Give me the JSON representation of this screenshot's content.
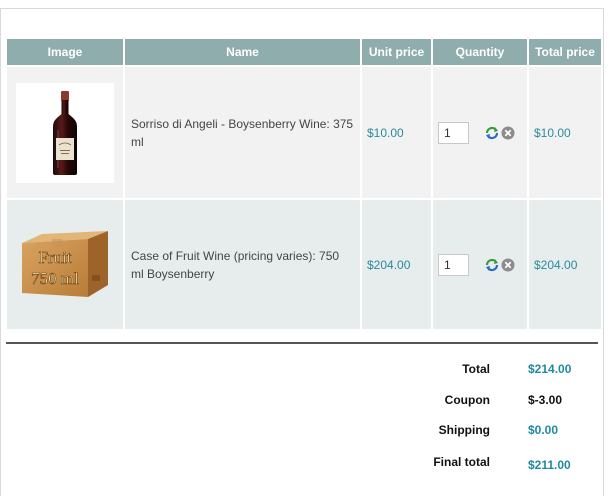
{
  "columns": {
    "image": "Image",
    "name": "Name",
    "unit_price": "Unit price",
    "quantity": "Quantity",
    "total_price": "Total price"
  },
  "items": [
    {
      "name": "Sorriso di Angeli - Boysenberry Wine: 375 ml",
      "unit_price": "$10.00",
      "quantity": "1",
      "total_price": "$10.00",
      "image_icon": "wine-bottle"
    },
    {
      "name": "Case of Fruit Wine (pricing varies): 750 ml Boysenberry",
      "unit_price": "$204.00",
      "quantity": "1",
      "total_price": "$204.00",
      "image_icon": "wine-case-box",
      "box_text_line1": "Fruit",
      "box_text_line2": "750 ml"
    }
  ],
  "summary": {
    "total_label": "Total",
    "total_value": "$214.00",
    "coupon_label": "Coupon",
    "coupon_value": "$-3.00",
    "shipping_label": "Shipping",
    "shipping_value": "$0.00",
    "final_label": "Final total",
    "final_value": "$211.00"
  },
  "colors": {
    "header_bg": "#8fadad",
    "row_a_bg": "#f2f2f2",
    "row_b_bg": "#e7eded",
    "price_text": "#2a8a9e"
  }
}
